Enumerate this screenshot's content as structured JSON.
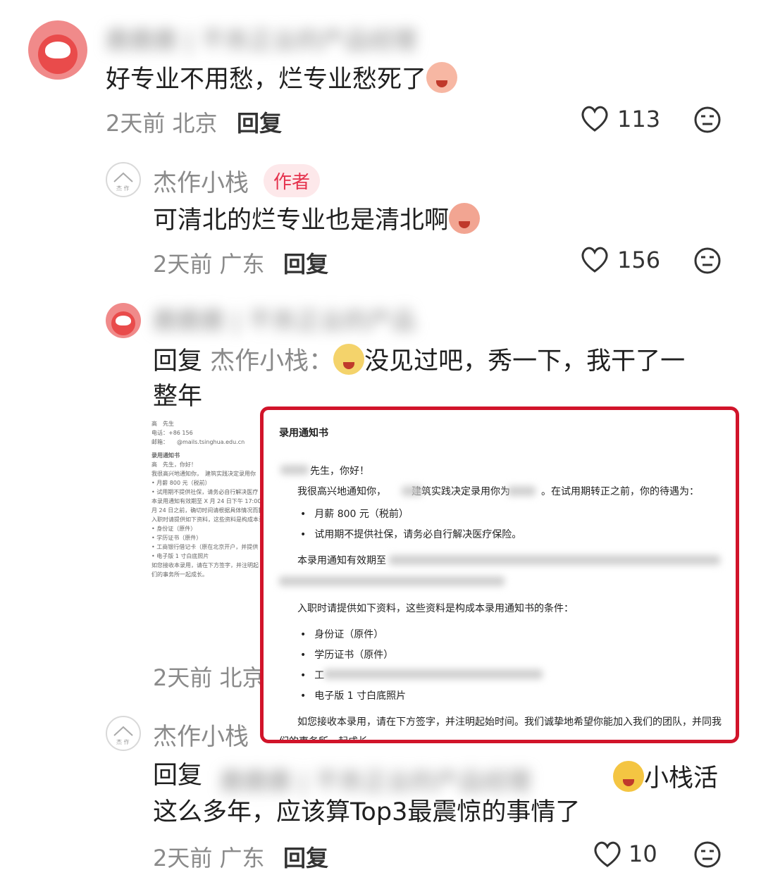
{
  "comment1": {
    "nickname_blurred": "鹿鹿鹿 | 不务正业的产品经理",
    "text": "好专业不用愁，烂专业愁死了",
    "time": "2天前",
    "location": "北京",
    "reply_label": "回复",
    "likes": "113"
  },
  "comment2": {
    "nickname": "杰作小栈",
    "badge": "作者",
    "text": "可清北的烂专业也是清北啊",
    "time": "2天前",
    "location": "广东",
    "reply_label": "回复",
    "likes": "156"
  },
  "comment3": {
    "nickname_blurred": "鹿鹿鹿 | 不务正业的产品",
    "reply_prefix": "回复",
    "reply_to": "杰作小栈：",
    "text_line1": "没见过吧，秀一下，我干了一",
    "text_line2": "整年",
    "time": "2天前",
    "location": "北京"
  },
  "doc_thumb": {
    "lines": [
      "高　先生",
      "电话：+86 156",
      "邮箱：　　@mails.tsinghua.edu.cn",
      "录用通知书",
      "高　先生，你好！",
      "我很高兴地通知你，　建筑实践决定录用你",
      "• 月薪 800 元（税前）",
      "• 试用期不提供社保，请务必自行解决医疗",
      "本录用通知有效期至 X 月 24 日下午 17:00",
      "月 24 日之前，确切时间请根据具体情况而我们商",
      "入职时请提供如下资料，这些资料是构成本录",
      "• 身份证（原件）",
      "• 学历证书（原件）",
      "• 工商银行借记卡（原在北京开户，并提供",
      "• 电子版 1 寸白底照片",
      "如您接收本录用，请在下方签字，并注明起",
      "们的事务所一起成长。"
    ]
  },
  "offer_popup": {
    "title": "录用通知书",
    "greeting": "先生，你好！",
    "intro_a": "我很高兴地通知你，",
    "intro_b": "建筑实践决定录用你为",
    "intro_c": "。在试用期转正之前，你的待遇为：",
    "salary": "月薪 800 元（税前）",
    "insurance": "试用期不提供社保，请务必自行解决医疗保险。",
    "validity": "本录用通知有效期至",
    "materials_intro": "入职时请提供如下资料，这些资料是构成本录用通知书的条件：",
    "item_id": "身份证（原件）",
    "item_diploma": "学历证书（原件）",
    "item_bank": "工",
    "item_photo": "电子版 1 寸白底照片",
    "closing1": "如您接收本录用，请在下方签字，并注明起始时间。我们诚挚地希望你能加入我们的团队，并同我",
    "closing2": "们的事务所一起成长。"
  },
  "comment4": {
    "nickname": "杰作小栈",
    "reply_prefix": "回复",
    "reply_to_blurred": "鹿鹿鹿 | 不务正业的产品经理",
    "text_tail": "小栈活",
    "text_line2": "这么多年，应该算Top3最震惊的事情了",
    "time": "2天前",
    "location": "广东",
    "reply_label": "回复",
    "likes": "10"
  },
  "colors": {
    "accent": "#d1142a",
    "badge_bg": "#fde8ea",
    "badge_text": "#e5324d",
    "meta": "#8a8a8a"
  },
  "icons": {
    "like": "heart-outline-icon",
    "dislike": "meh-face-icon"
  }
}
